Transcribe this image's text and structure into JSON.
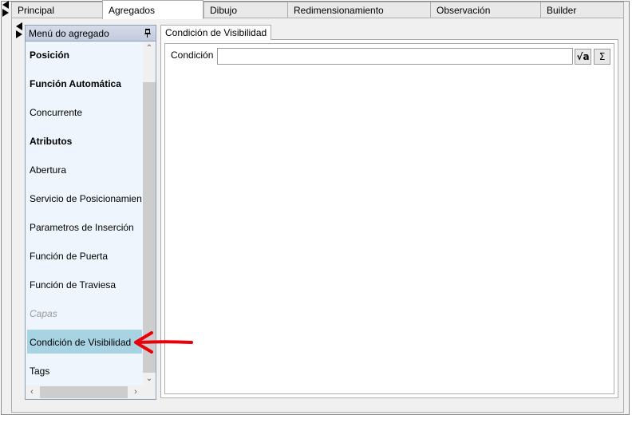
{
  "tabs": [
    {
      "label": "Principal",
      "active": false
    },
    {
      "label": "Agregados",
      "active": true
    },
    {
      "label": "Dibujo",
      "active": false
    },
    {
      "label": "Redimensionamiento",
      "active": false
    },
    {
      "label": "Observación",
      "active": false
    },
    {
      "label": "Builder",
      "active": false
    }
  ],
  "menu": {
    "title": "Menú do agregado",
    "items": [
      {
        "label": "Posición",
        "style": "bold"
      },
      {
        "label": "Función Automática",
        "style": "bold"
      },
      {
        "label": "Concurrente",
        "style": "normal"
      },
      {
        "label": "Atributos",
        "style": "bold"
      },
      {
        "label": "Abertura",
        "style": "normal"
      },
      {
        "label": "Servicio de Posicionamiento",
        "style": "normal"
      },
      {
        "label": "Parametros de Inserción",
        "style": "normal"
      },
      {
        "label": "Función de Puerta",
        "style": "normal"
      },
      {
        "label": "Función de Traviesa",
        "style": "normal"
      },
      {
        "label": "Capas",
        "style": "disabled"
      },
      {
        "label": "Condición de Visibilidad",
        "style": "selected"
      },
      {
        "label": "Tags",
        "style": "normal"
      }
    ]
  },
  "detail": {
    "tab_label": "Condición de Visibilidad",
    "condition_label": "Condición",
    "condition_value": "",
    "sqrt_symbol": "√a",
    "sigma_symbol": "Σ"
  },
  "icons": {
    "pin": "pin-icon",
    "arrow_left": "arrow-left-icon",
    "arrow_right": "arrow-right-icon"
  },
  "colors": {
    "selected_bg": "#a7d3e3",
    "menu_bg": "#eef5fc",
    "annotation": "#e8000b"
  }
}
